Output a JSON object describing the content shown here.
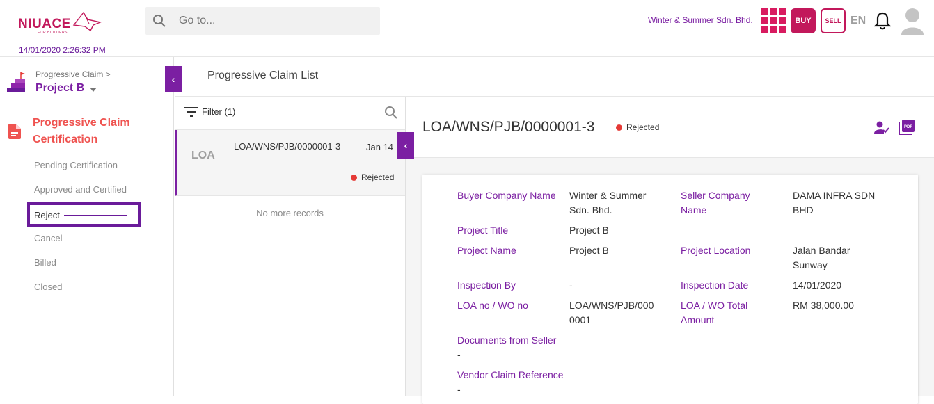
{
  "header": {
    "logo_text": "NIUACE",
    "logo_tagline": "FOR BUILDERS",
    "search_placeholder": "Go to...",
    "company": "Winter & Summer Sdn. Bhd.",
    "buy_label": "BUY",
    "sell_label": "SELL",
    "lang": "EN",
    "timestamp": "14/01/2020 2:26:32 PM"
  },
  "sidebar": {
    "breadcrumb": "Progressive Claim >",
    "project": "Project B",
    "section_title": "Progressive Claim Certification",
    "items": [
      {
        "label": "Pending Certification"
      },
      {
        "label": "Approved and Certified"
      },
      {
        "label": "Reject"
      },
      {
        "label": "Cancel"
      },
      {
        "label": "Billed"
      },
      {
        "label": "Closed"
      }
    ]
  },
  "main": {
    "list_title": "Progressive Claim List",
    "filter_label": "Filter (1)",
    "list_items": [
      {
        "abbr": "LOA",
        "ref": "LOA/WNS/PJB/0000001-3",
        "date": "Jan 14",
        "status": "Rejected"
      }
    ],
    "no_more": "No more records"
  },
  "detail": {
    "ref": "LOA/WNS/PJB/0000001-3",
    "status": "Rejected",
    "fields": {
      "buyer_company_label": "Buyer Company Name",
      "buyer_company_value": "Winter & Summer Sdn. Bhd.",
      "seller_company_label": "Seller Company Name",
      "seller_company_value": "DAMA INFRA SDN BHD",
      "project_title_label": "Project Title",
      "project_title_value": "Project B",
      "project_name_label": "Project Name",
      "project_name_value": "Project B",
      "project_location_label": "Project Location",
      "project_location_value": "Jalan Bandar Sunway",
      "inspection_by_label": "Inspection By",
      "inspection_by_value": "-",
      "inspection_date_label": "Inspection Date",
      "inspection_date_value": "14/01/2020",
      "loa_no_label": "LOA no / WO no",
      "loa_no_value": "LOA/WNS/PJB/0000001",
      "loa_total_label": "LOA / WO Total Amount",
      "loa_total_value": "RM 38,000.00",
      "documents_label": "Documents from Seller",
      "documents_value": "-",
      "vendor_ref_label": "Vendor Claim Reference",
      "vendor_ref_value": "-"
    }
  },
  "colors": {
    "accent": "#7b1fa2",
    "brand": "#c2185b",
    "section": "#ef5350",
    "status_rejected": "#e53935"
  }
}
